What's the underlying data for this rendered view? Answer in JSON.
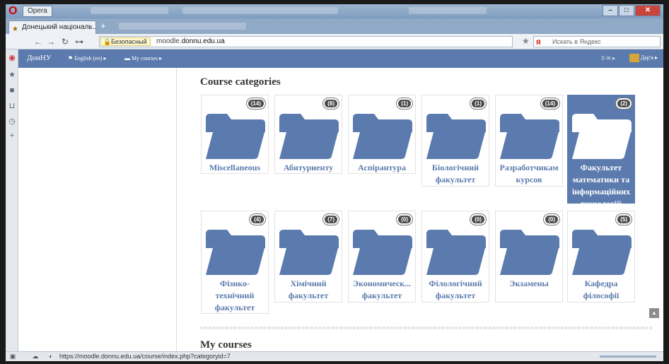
{
  "browser": {
    "menu_label": "Opera",
    "tab_title": "Донецький національ...",
    "tab_close": "×",
    "new_tab": "+",
    "secure_label": "Безопасный",
    "url_prefix": "moodle.",
    "url_domain": "donnu.edu.ua",
    "search_placeholder": "Искать в Яндекс",
    "status_url": "https://moodle.donnu.edu.ua/course/index.php?categoryid=7"
  },
  "moodle_bar": {
    "brand": "ДонНУ",
    "language": "English (en) ▸",
    "my_courses": "My courses ▸",
    "messages": "0 ✉ ▸",
    "user": "Дар'я ▸"
  },
  "page": {
    "categories_heading": "Course categories",
    "my_courses_heading": "My courses",
    "scroll_top": "▲"
  },
  "colors": {
    "accent": "#5b7aad",
    "badge": "#4a4a4a"
  },
  "categories": [
    {
      "name": "Miscellaneous",
      "count": "(14)",
      "active": false
    },
    {
      "name": "Абитуриенту",
      "count": "(8)",
      "active": false
    },
    {
      "name": "Аспірантура",
      "count": "(1)",
      "active": false
    },
    {
      "name": "Біологічний факультет",
      "count": "(1)",
      "active": false
    },
    {
      "name": "Разработчикам курсов",
      "count": "(14)",
      "active": false
    },
    {
      "name": "Факультет математики та інформаційних технологій",
      "count": "(2)",
      "active": true
    },
    {
      "name": "Фізико-технічний факультет",
      "count": "(4)",
      "active": false
    },
    {
      "name": "Хімічний факультет",
      "count": "(7)",
      "active": false
    },
    {
      "name": "Экономическ... факультет",
      "count": "(0)",
      "active": false
    },
    {
      "name": "Філологічний факультет",
      "count": "(0)",
      "active": false
    },
    {
      "name": "Экзамены",
      "count": "(0)",
      "active": false
    },
    {
      "name": "Кафедра філософії",
      "count": "(5)",
      "active": false
    }
  ]
}
